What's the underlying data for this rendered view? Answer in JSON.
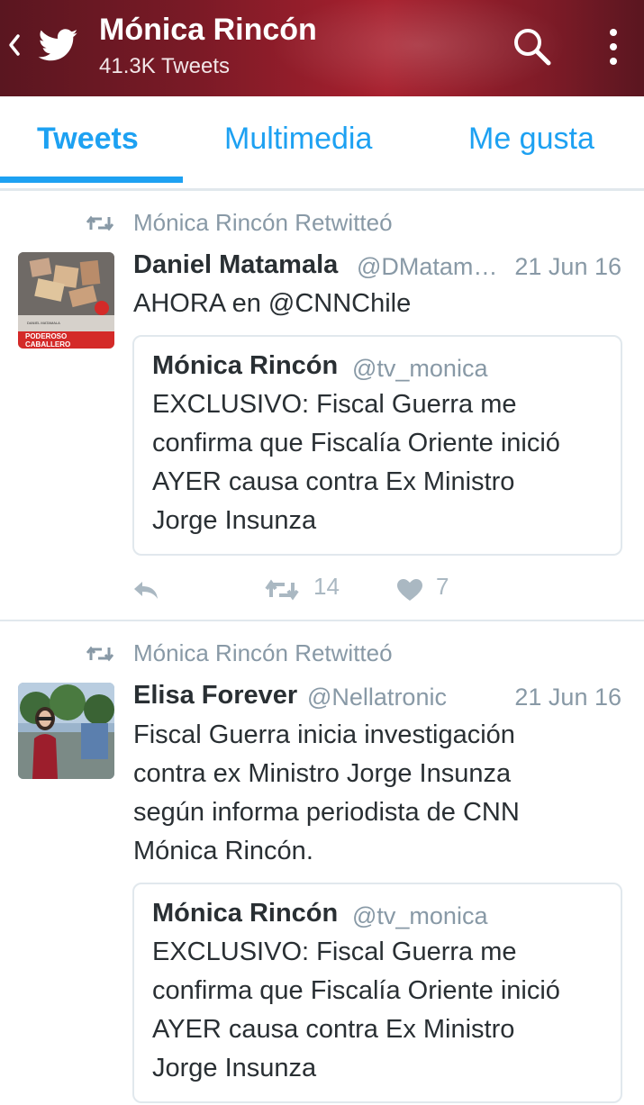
{
  "header": {
    "title": "Mónica Rincón",
    "subtitle": "41.3K Tweets",
    "icons": [
      "back-icon",
      "twitter-bird-icon",
      "search-icon",
      "more-vertical-icon"
    ]
  },
  "tabs": [
    {
      "label": "Tweets",
      "active": true
    },
    {
      "label": "Multimedia",
      "active": false
    },
    {
      "label": "Me gusta",
      "active": false
    }
  ],
  "tweets": [
    {
      "retweet_label": "Mónica Rincón Retwitteó",
      "author_name": "Daniel Matamala",
      "author_handle": "@DMatam…",
      "date": "21 Jun 16",
      "text": "AHORA en @CNNChile",
      "avatar_book_author": "DANIEL MATAMALA",
      "avatar_book_title_1": "PODEROSO",
      "avatar_book_title_2": "CABALLERO",
      "quote": {
        "author_name": "Mónica Rincón",
        "author_handle": "@tv_monica",
        "text": "EXCLUSIVO: Fiscal Guerra me\nconfirma que Fiscalía Oriente inició\nAYER causa contra Ex Ministro\nJorge Insunza"
      },
      "retweet_count": "14",
      "like_count": "7"
    },
    {
      "retweet_label": "Mónica Rincón Retwitteó",
      "author_name": "Elisa Forever",
      "author_handle": "@Nellatronic",
      "date": "21 Jun 16",
      "text": "Fiscal Guerra inicia investigación\ncontra ex Ministro Jorge Insunza\nsegún informa periodista de CNN\nMónica Rincón.",
      "quote": {
        "author_name": "Mónica Rincón",
        "author_handle": "@tv_monica",
        "text": "EXCLUSIVO: Fiscal Guerra me\nconfirma que Fiscalía Oriente inició\nAYER causa contra Ex Ministro\nJorge Insunza"
      }
    }
  ],
  "colors": {
    "accent": "#1da1f2",
    "header_bg": "#7a1a26",
    "muted": "#8899a6"
  }
}
